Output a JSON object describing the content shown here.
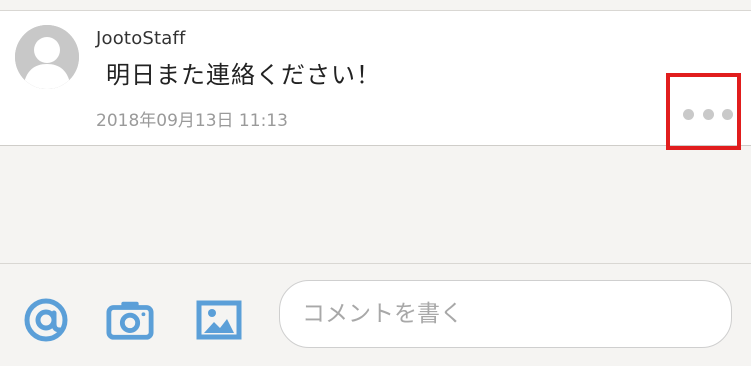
{
  "comment": {
    "author": "JootoStaff",
    "body": "明日また連絡ください！",
    "timestamp": "2018年09月13日 11:13"
  },
  "toolbar": {
    "icons": [
      "at-icon",
      "camera-icon",
      "image-icon"
    ],
    "comment_placeholder": "コメントを書く"
  },
  "colors": {
    "highlight": "#e11d1d",
    "toolbar_icon": "#5b9fd8",
    "avatar_bg": "#c8c8c8"
  }
}
